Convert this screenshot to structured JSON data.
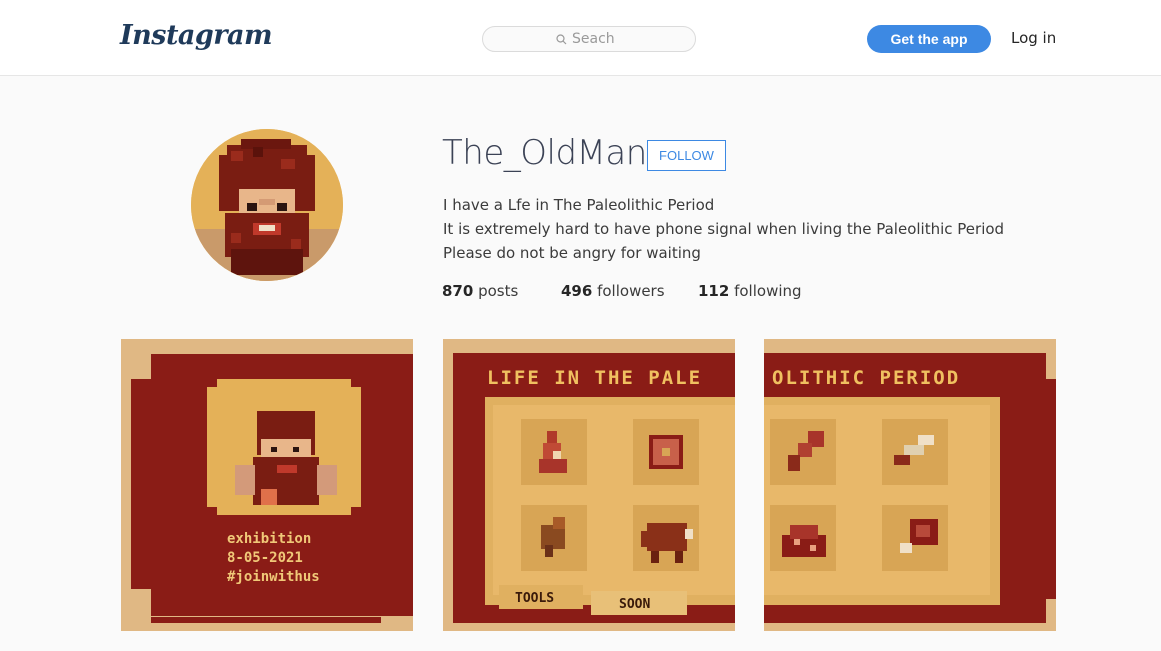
{
  "header": {
    "logo": "Instagram",
    "search_placeholder": "Seach",
    "get_app": "Get the app",
    "login": "Log in"
  },
  "profile": {
    "username": "The_OldMan",
    "follow": "FOLLOW",
    "bio": [
      "I have a Lfe in The Paleolithic Period",
      "It is extremely hard to have phone signal when living the Paleolithic Period",
      "Please do not be angry for waiting"
    ],
    "stats": {
      "posts_count": "870",
      "posts_label": "posts",
      "followers_count": "496",
      "followers_label": "followers",
      "following_count": "112",
      "following_label": "following"
    }
  },
  "posts": {
    "post1": {
      "lines": [
        "exhibition",
        "8-05-2021",
        "#joinwithus"
      ]
    },
    "post2": {
      "banner": "LIFE IN THE PALE",
      "tab_tools": "TOOLS",
      "tab_soon": "SOON"
    },
    "post3": {
      "banner": "OLITHIC PERIOD"
    }
  },
  "colors": {
    "brand_blue": "#3d89e3",
    "maroon": "#8a1c16",
    "ochre": "#e4b158",
    "tan": "#e0b884"
  }
}
